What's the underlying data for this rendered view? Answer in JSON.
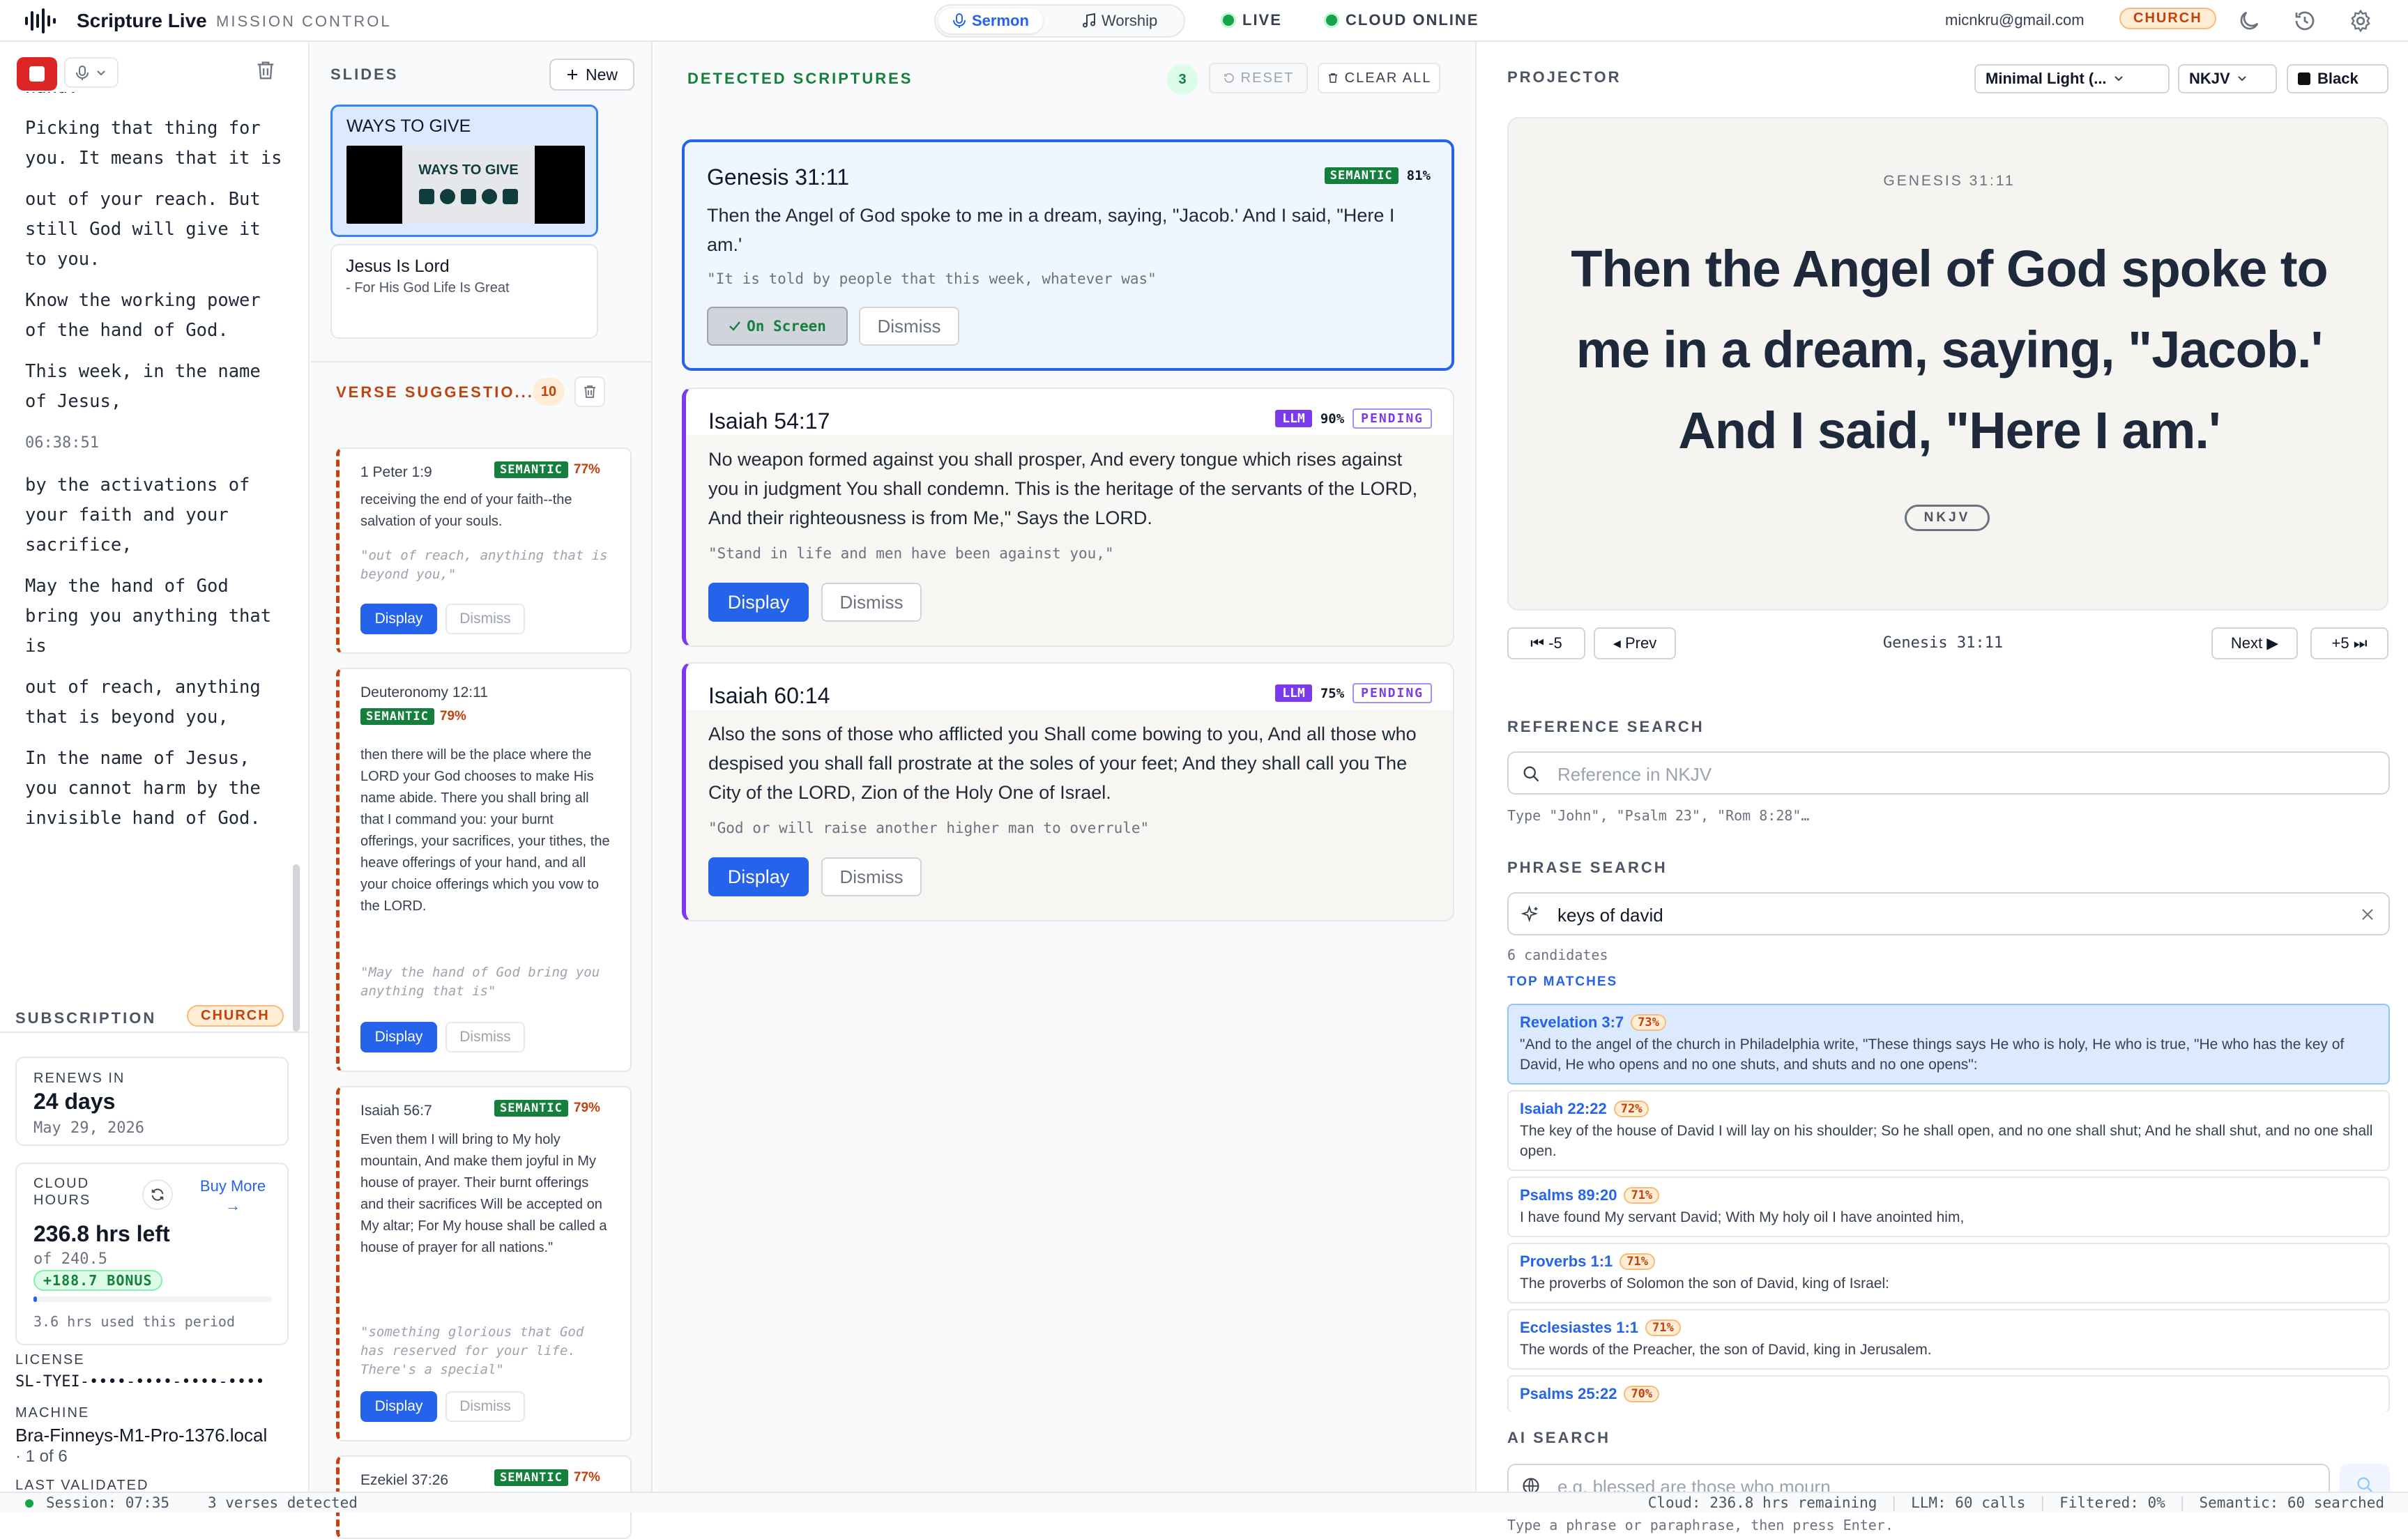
{
  "app": {
    "title": "Scripture Live",
    "subtitle": "MISSION CONTROL"
  },
  "modes": [
    {
      "label": "Sermon",
      "active": true
    },
    {
      "label": "Worship",
      "active": false
    }
  ],
  "status": {
    "live": "LIVE",
    "cloud": "CLOUD ONLINE"
  },
  "user": {
    "email": "micnkru@gmail.com",
    "plan": "CHURCH"
  },
  "transcript": {
    "lines": [
      "hand.",
      "Picking that thing for you. It means that it is",
      "out of your reach. But still God will give it to you.",
      "Know the working power of the hand of God.",
      "This week, in the name of Jesus,"
    ],
    "timestamp": "06:38:51",
    "lines2": [
      "by the activations of your faith and your sacrifice,",
      "May the hand of God bring you anything that is",
      "out of reach, anything that is beyond you,",
      "In the name of Jesus, you cannot harm by the invisible hand of God."
    ]
  },
  "subscription": {
    "title": "SUBSCRIPTION",
    "plan": "CHURCH",
    "renews_label": "RENEWS IN",
    "renews_value": "24 days",
    "renews_date": "May 29, 2026",
    "cloud_label": "CLOUD HOURS",
    "buy_more": "Buy More →",
    "hours_left": "236.8 hrs left",
    "hours_total": "of 240.5",
    "bonus": "+188.7 BONUS",
    "hours_used_fraction": 0.015,
    "hours_used": "3.6 hrs used this period",
    "license_label": "LICENSE",
    "license_value": "SL-TYEI-••••-••••-••••-••••",
    "machine_label": "MACHINE",
    "machine_value": "Bra-Finneys-M1-Pro-1376.local",
    "machine_count": "· 1 of 6",
    "last_validated_label": "LAST VALIDATED"
  },
  "slides": {
    "title": "SLIDES",
    "new_label": "New",
    "items": [
      {
        "title": "WAYS TO GIVE",
        "thumb_text": "WAYS TO GIVE"
      },
      {
        "title": "Jesus Is Lord",
        "subtitle": "- For His God Life Is Great"
      }
    ]
  },
  "suggestions": {
    "title": "VERSE SUGGESTIO...",
    "count": "10",
    "display_label": "Display",
    "dismiss_label": "Dismiss",
    "items": [
      {
        "ref": "1 Peter 1:9",
        "badge": "SEMANTIC",
        "pct": "77%",
        "text": "receiving the end of your faith--the salvation of your souls.",
        "quote": "\"out of reach, anything that is beyond you,\""
      },
      {
        "ref": "Deuteronomy 12:11",
        "badge": "SEMANTIC",
        "pct": "79%",
        "text": "then there will be the place where the LORD your God chooses to make His name abide. There you shall bring all that I command you: your burnt offerings, your sacrifices, your tithes, the heave offerings of your hand, and all your choice offerings which you vow to the LORD.",
        "quote": "\"May the hand of God bring you anything that is\""
      },
      {
        "ref": "Isaiah 56:7",
        "badge": "SEMANTIC",
        "pct": "79%",
        "text": "Even them I will bring to My holy mountain, And make them joyful in My house of prayer. Their burnt offerings and their sacrifices Will be accepted on My altar; For My house shall be called a house of prayer for all nations.\"",
        "quote": "\"something glorious that God has reserved for your life. There's a special\""
      },
      {
        "ref": "Ezekiel 37:26",
        "badge": "SEMANTIC",
        "pct": "77%"
      }
    ]
  },
  "detected": {
    "title": "DETECTED SCRIPTURES",
    "count": "3",
    "reset_label": "RESET",
    "clear_label": "CLEAR ALL",
    "on_screen_label": "On Screen",
    "display_label": "Display",
    "dismiss_label": "Dismiss",
    "items": [
      {
        "ref": "Genesis 31:11",
        "badge": "SEMANTIC",
        "pct": "81%",
        "text": "Then the Angel of God spoke to me in a dream, saying, \"Jacob.' And I said, \"Here I am.'",
        "quote": "\"It is told by people that this week, whatever was\""
      },
      {
        "ref": "Isaiah 54:17",
        "badge": "LLM",
        "pct": "90%",
        "status": "PENDING",
        "text": "No weapon formed against you shall prosper, And every tongue which rises against you in judgment You shall condemn. This is the heritage of the servants of the LORD, And their righteousness is from Me,\" Says the LORD.",
        "quote": "\"Stand in life and men have been against you,\""
      },
      {
        "ref": "Isaiah 60:14",
        "badge": "LLM",
        "pct": "75%",
        "status": "PENDING",
        "text": "Also the sons of those who afflicted you Shall come bowing to you, And all those who despised you shall fall prostrate at the soles of your feet; And they shall call you The City of the LORD, Zion of the Holy One of Israel.",
        "quote": "\"God or will raise another higher man to overrule\""
      }
    ]
  },
  "projector": {
    "title": "PROJECTOR",
    "theme": "Minimal Light (...",
    "version": "NKJV",
    "background": "Black",
    "ref": "GENESIS 31:11",
    "text": "Then the Angel of God spoke to me in a dream, saying, \"Jacob.' And I said, \"Here I am.'",
    "version_badge": "NKJV",
    "nav": {
      "back5": "⏮ -5",
      "prev": "◂ Prev",
      "current": "Genesis 31:11",
      "next": "Next ▶",
      "fwd5": "+5 ⏭"
    }
  },
  "reference_search": {
    "title": "REFERENCE SEARCH",
    "placeholder": "Reference in NKJV",
    "hint": "Type \"John\", \"Psalm 23\", \"Rom 8:28\"…"
  },
  "phrase_search": {
    "title": "PHRASE SEARCH",
    "value": "keys of david",
    "candidates": "6 candidates",
    "top_matches": "TOP MATCHES",
    "matches": [
      {
        "ref": "Revelation 3:7",
        "pct": "73%",
        "text": "\"And to the angel of the church in Philadelphia write, \"These things says He who is holy, He who is true, \"He who has the key of David, He who opens and no one shuts, and shuts and no one opens\":"
      },
      {
        "ref": "Isaiah 22:22",
        "pct": "72%",
        "text": "The key of the house of David I will lay on his shoulder; So he shall open, and no one shall shut; And he shall shut, and no one shall open."
      },
      {
        "ref": "Psalms 89:20",
        "pct": "71%",
        "text": "I have found My servant David; With My holy oil I have anointed him,"
      },
      {
        "ref": "Proverbs 1:1",
        "pct": "71%",
        "text": "The proverbs of Solomon the son of David, king of Israel:"
      },
      {
        "ref": "Ecclesiastes 1:1",
        "pct": "71%",
        "text": "The words of the Preacher, the son of David, king in Jerusalem."
      },
      {
        "ref": "Psalms 25:22",
        "pct": "70%",
        "text": ""
      }
    ]
  },
  "ai_search": {
    "title": "AI SEARCH",
    "placeholder": "e.g. blessed are those who mourn",
    "hint": "Type a phrase or paraphrase, then press Enter."
  },
  "statusbar": {
    "session": "Session: 07:35",
    "verses": "3 verses detected",
    "cloud": "Cloud: 236.8 hrs remaining",
    "llm": "LLM: 60 calls",
    "filtered": "Filtered: 0%",
    "semantic": "Semantic: 60 searched"
  },
  "colors": {
    "accent": "#2563eb",
    "semantic": "#15803d",
    "llm": "#7c3aed",
    "church": "#c2410c",
    "record": "#dc2626"
  }
}
